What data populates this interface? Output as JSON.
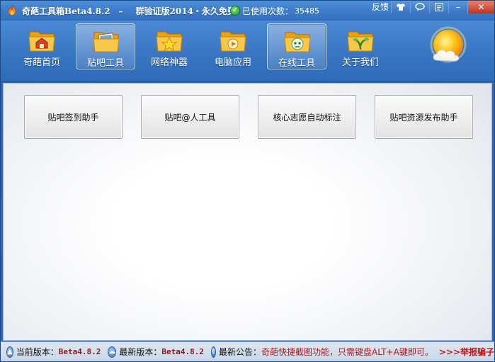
{
  "window": {
    "app_title": "奇葩工具箱Beta4.8.2",
    "title_separator": "–",
    "title_edition": "群验证版2014・永久免费",
    "usage_label": "已使用次数：",
    "usage_count": "35485"
  },
  "system_buttons": {
    "feedback": "反馈",
    "skin_icon": "shirt-icon",
    "chat_icon": "speech-bubble-icon",
    "menu_icon": "menu-icon",
    "minimize": "–",
    "close": "✕"
  },
  "nav": {
    "items": [
      {
        "label": "奇葩首页",
        "icon": "home-folder-icon"
      },
      {
        "label": "贴吧工具",
        "icon": "photo-folder-icon"
      },
      {
        "label": "网络神器",
        "icon": "star-folder-icon"
      },
      {
        "label": "电脑应用",
        "icon": "media-folder-icon"
      },
      {
        "label": "在线工具",
        "icon": "robot-folder-icon"
      },
      {
        "label": "关于我们",
        "icon": "plant-folder-icon"
      }
    ],
    "active": "在线工具",
    "hover": "贴吧工具",
    "weather_icon": "sun-cloud-icon"
  },
  "tools": {
    "buttons": [
      {
        "label": "贴吧签到助手"
      },
      {
        "label": "贴吧@人工具"
      },
      {
        "label": "核心志愿自动标注"
      },
      {
        "label": "贴吧资源发布助手"
      }
    ]
  },
  "status": {
    "current_version_label": "当前版本：",
    "current_version": "Beta4.8.2",
    "latest_version_label": "最新版本：",
    "latest_version": "Beta4.8.2",
    "notice_label": "最新公告：",
    "notice_text": "奇葩快捷截图功能，只需键盘ALT+A键即可。",
    "report_link": ">>>举报骗子"
  },
  "colors": {
    "title_blue": "#3d7cc8",
    "content_bg": "#ffffff",
    "status_red": "#b01a1a",
    "version_color": "#8b1a1a"
  }
}
